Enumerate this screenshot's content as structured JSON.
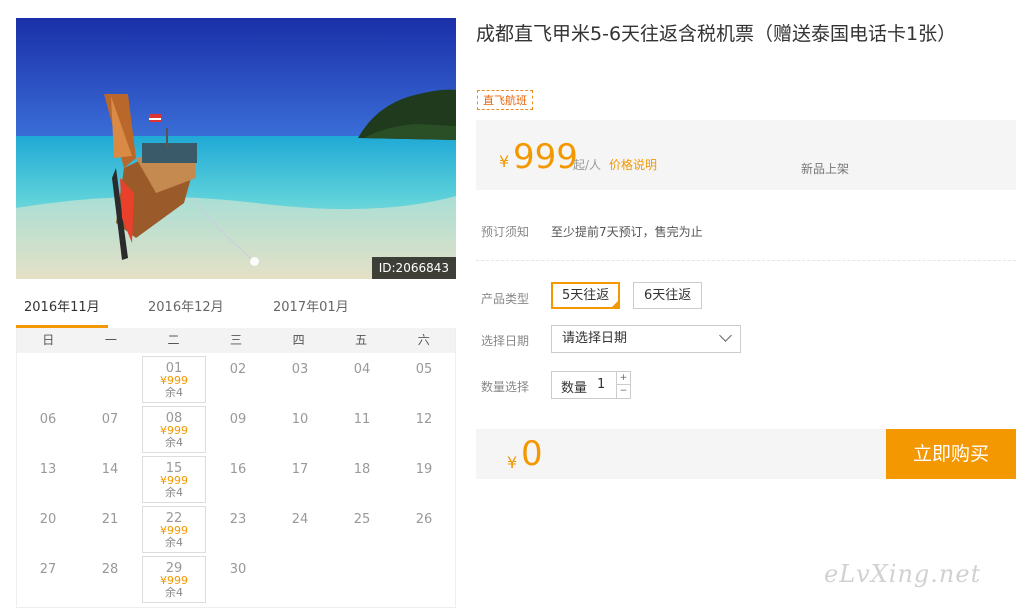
{
  "image": {
    "id_label": "ID:2066843"
  },
  "product": {
    "title": "成都直飞甲米5-6天往返含税机票（赠送泰国电话卡1张）",
    "tag": "直飞航班"
  },
  "price": {
    "currency": "¥",
    "amount": "999",
    "unit": "起/人",
    "explain_link": "价格说明",
    "status": "新品上架"
  },
  "notice": {
    "label": "预订须知",
    "text": "至少提前7天预订，售完为止"
  },
  "options": {
    "type_label": "产品类型",
    "types": [
      {
        "label": "5天往返",
        "selected": true
      },
      {
        "label": "6天往返",
        "selected": false
      }
    ],
    "date_label": "选择日期",
    "date_placeholder": "请选择日期",
    "qty_label": "数量选择",
    "qty_field_label": "数量",
    "qty_value": "1",
    "qty_up": "+",
    "qty_down": "−"
  },
  "total": {
    "currency": "¥",
    "amount": "0"
  },
  "buy_button": "立即购买",
  "calendar": {
    "months": [
      "2016年11月",
      "2016年12月",
      "2017年01月"
    ],
    "active_month": 0,
    "weekdays": [
      "日",
      "一",
      "二",
      "三",
      "四",
      "五",
      "六"
    ],
    "weeks": [
      [
        null,
        null,
        {
          "d": "01",
          "price": "¥999",
          "left": "余4"
        },
        {
          "d": "02"
        },
        {
          "d": "03"
        },
        {
          "d": "04"
        },
        {
          "d": "05"
        }
      ],
      [
        {
          "d": "06"
        },
        {
          "d": "07"
        },
        {
          "d": "08",
          "price": "¥999",
          "left": "余4"
        },
        {
          "d": "09"
        },
        {
          "d": "10"
        },
        {
          "d": "11"
        },
        {
          "d": "12"
        }
      ],
      [
        {
          "d": "13"
        },
        {
          "d": "14"
        },
        {
          "d": "15",
          "price": "¥999",
          "left": "余4"
        },
        {
          "d": "16"
        },
        {
          "d": "17"
        },
        {
          "d": "18"
        },
        {
          "d": "19"
        }
      ],
      [
        {
          "d": "20"
        },
        {
          "d": "21"
        },
        {
          "d": "22",
          "price": "¥999",
          "left": "余4"
        },
        {
          "d": "23"
        },
        {
          "d": "24"
        },
        {
          "d": "25"
        },
        {
          "d": "26"
        }
      ],
      [
        {
          "d": "27"
        },
        {
          "d": "28"
        },
        {
          "d": "29",
          "price": "¥999",
          "left": "余4"
        },
        {
          "d": "30"
        },
        null,
        null,
        null
      ]
    ]
  },
  "watermark": "eLvXing.net",
  "colors": {
    "accent": "#f39800",
    "tag": "#e8650a",
    "panel": "#f5f5f5"
  }
}
